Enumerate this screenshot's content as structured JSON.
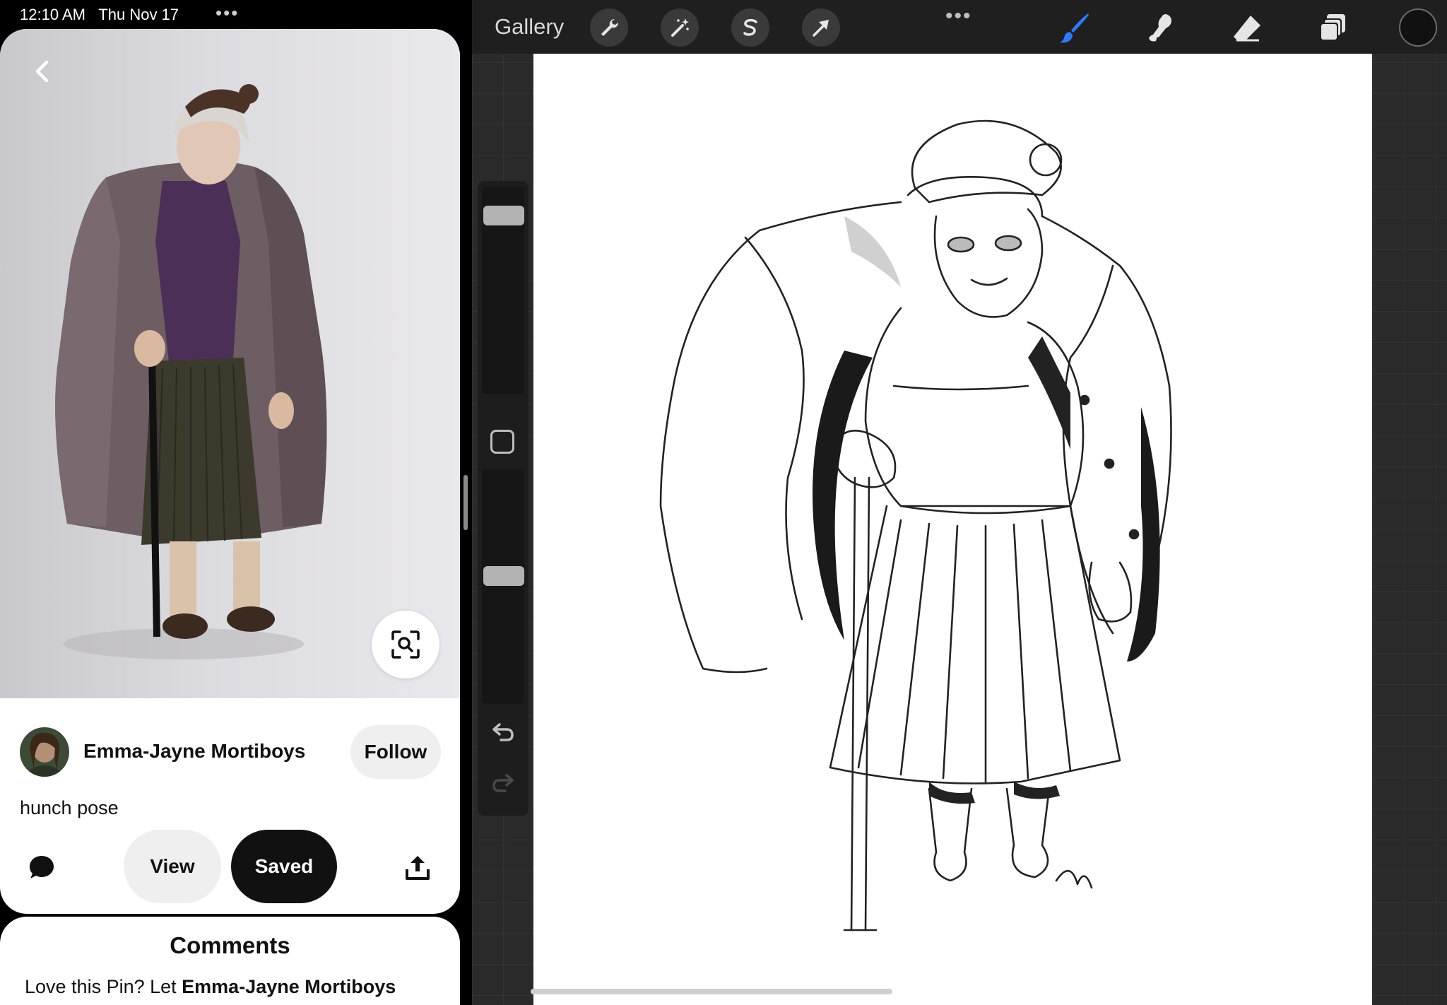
{
  "status_bar": {
    "time": "12:10 AM",
    "date": "Thu Nov 17",
    "multitask": "•••"
  },
  "pinterest": {
    "author": "Emma-Jayne Mortiboys",
    "follow_label": "Follow",
    "description": "hunch pose",
    "view_label": "View",
    "saved_label": "Saved",
    "comments_title": "Comments",
    "comments_prompt_prefix": "Love this Pin? Let ",
    "comments_prompt_author": "Emma-Jayne Mortiboys",
    "icons": {
      "back": "chevron-left-icon",
      "visual_search": "visual-search-icon",
      "comment": "speech-bubble-icon",
      "share": "share-icon"
    }
  },
  "procreate": {
    "gallery_label": "Gallery",
    "more": "•••",
    "tools": [
      "wrench-icon",
      "magic-wand-icon",
      "selection-icon",
      "transform-arrow-icon"
    ],
    "right_tools": [
      "brush-icon",
      "smudge-icon",
      "eraser-icon",
      "layers-icon"
    ],
    "active_tool": "brush",
    "colors": {
      "accent": "#2f7bf6",
      "current_color": "#111111",
      "toolbar": "#1f1f20",
      "background": "#2a2a2b"
    },
    "brush_size": 0.9,
    "brush_opacity": 0.55
  }
}
